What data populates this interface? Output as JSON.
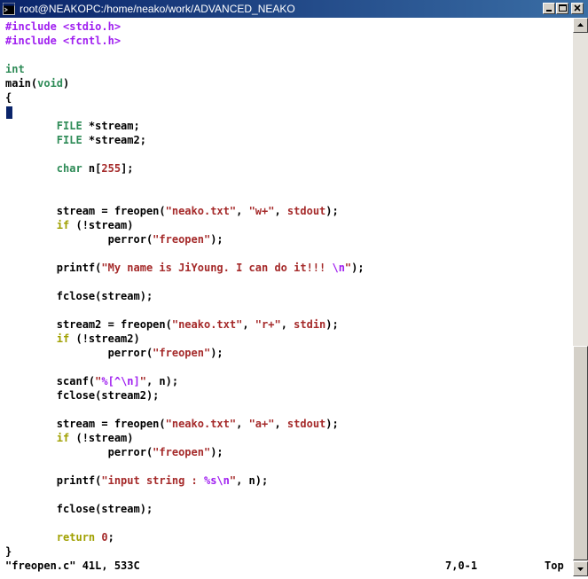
{
  "window": {
    "title": "root@NEAKOPC:/home/neako/work/ADVANCED_NEAKO"
  },
  "editor": {
    "lines": [
      {
        "parts": [
          {
            "t": "#include <stdio.h>",
            "c": "pre"
          }
        ]
      },
      {
        "parts": [
          {
            "t": "#include <fcntl.h>",
            "c": "pre"
          }
        ]
      },
      {
        "parts": []
      },
      {
        "parts": [
          {
            "t": "int",
            "c": "type"
          }
        ]
      },
      {
        "parts": [
          {
            "t": "main("
          },
          {
            "t": "void",
            "c": "type"
          },
          {
            "t": ")"
          }
        ]
      },
      {
        "parts": [
          {
            "t": "{"
          }
        ]
      },
      {
        "parts": []
      },
      {
        "parts": [
          {
            "t": "        "
          },
          {
            "t": "FILE",
            "c": "type"
          },
          {
            "t": " *stream;"
          }
        ]
      },
      {
        "parts": [
          {
            "t": "        "
          },
          {
            "t": "FILE",
            "c": "type"
          },
          {
            "t": " *stream2;"
          }
        ]
      },
      {
        "parts": []
      },
      {
        "parts": [
          {
            "t": "        "
          },
          {
            "t": "char",
            "c": "type"
          },
          {
            "t": " n["
          },
          {
            "t": "255",
            "c": "const"
          },
          {
            "t": "];"
          }
        ]
      },
      {
        "parts": []
      },
      {
        "parts": []
      },
      {
        "parts": [
          {
            "t": "        stream = freopen("
          },
          {
            "t": "\"neako.txt\"",
            "c": "str"
          },
          {
            "t": ", "
          },
          {
            "t": "\"w+\"",
            "c": "str"
          },
          {
            "t": ", "
          },
          {
            "t": "stdout",
            "c": "str"
          },
          {
            "t": ");"
          }
        ]
      },
      {
        "parts": [
          {
            "t": "        "
          },
          {
            "t": "if",
            "c": "stmt"
          },
          {
            "t": " (!stream)"
          }
        ]
      },
      {
        "parts": [
          {
            "t": "                perror("
          },
          {
            "t": "\"freopen\"",
            "c": "str"
          },
          {
            "t": ");"
          }
        ]
      },
      {
        "parts": []
      },
      {
        "parts": [
          {
            "t": "        printf("
          },
          {
            "t": "\"My name is JiYoung. I can do it!!! ",
            "c": "str"
          },
          {
            "t": "\\n",
            "c": "esc"
          },
          {
            "t": "\"",
            "c": "str"
          },
          {
            "t": ");"
          }
        ]
      },
      {
        "parts": []
      },
      {
        "parts": [
          {
            "t": "        fclose(stream);"
          }
        ]
      },
      {
        "parts": []
      },
      {
        "parts": [
          {
            "t": "        stream2 = freopen("
          },
          {
            "t": "\"neako.txt\"",
            "c": "str"
          },
          {
            "t": ", "
          },
          {
            "t": "\"r+\"",
            "c": "str"
          },
          {
            "t": ", "
          },
          {
            "t": "stdin",
            "c": "str"
          },
          {
            "t": ");"
          }
        ]
      },
      {
        "parts": [
          {
            "t": "        "
          },
          {
            "t": "if",
            "c": "stmt"
          },
          {
            "t": " (!stream2)"
          }
        ]
      },
      {
        "parts": [
          {
            "t": "                perror("
          },
          {
            "t": "\"freopen\"",
            "c": "str"
          },
          {
            "t": ");"
          }
        ]
      },
      {
        "parts": []
      },
      {
        "parts": [
          {
            "t": "        scanf("
          },
          {
            "t": "\"",
            "c": "str"
          },
          {
            "t": "%[^\\n]",
            "c": "esc"
          },
          {
            "t": "\"",
            "c": "str"
          },
          {
            "t": ", n);"
          }
        ]
      },
      {
        "parts": [
          {
            "t": "        fclose(stream2);"
          }
        ]
      },
      {
        "parts": []
      },
      {
        "parts": [
          {
            "t": "        stream = freopen("
          },
          {
            "t": "\"neako.txt\"",
            "c": "str"
          },
          {
            "t": ", "
          },
          {
            "t": "\"a+\"",
            "c": "str"
          },
          {
            "t": ", "
          },
          {
            "t": "stdout",
            "c": "str"
          },
          {
            "t": ");"
          }
        ]
      },
      {
        "parts": [
          {
            "t": "        "
          },
          {
            "t": "if",
            "c": "stmt"
          },
          {
            "t": " (!stream)"
          }
        ]
      },
      {
        "parts": [
          {
            "t": "                perror("
          },
          {
            "t": "\"freopen\"",
            "c": "str"
          },
          {
            "t": ");"
          }
        ]
      },
      {
        "parts": []
      },
      {
        "parts": [
          {
            "t": "        printf("
          },
          {
            "t": "\"input string : ",
            "c": "str"
          },
          {
            "t": "%s\\n",
            "c": "esc"
          },
          {
            "t": "\"",
            "c": "str"
          },
          {
            "t": ", n);"
          }
        ]
      },
      {
        "parts": []
      },
      {
        "parts": [
          {
            "t": "        fclose(stream);"
          }
        ]
      },
      {
        "parts": []
      },
      {
        "parts": [
          {
            "t": "        "
          },
          {
            "t": "return",
            "c": "stmt"
          },
          {
            "t": " "
          },
          {
            "t": "0",
            "c": "const"
          },
          {
            "t": ";"
          }
        ]
      },
      {
        "parts": [
          {
            "t": "}"
          }
        ]
      }
    ]
  },
  "status": {
    "file": "\"freopen.c\" 41L, 533C",
    "position": "7,0-1",
    "scroll": "Top"
  },
  "colors": {
    "preproc": "#a020f0",
    "type": "#2e8b57",
    "string": "#a52a2a",
    "statement": "#a0a000",
    "cursor": "#0a246a"
  },
  "icons": [
    "terminal-icon",
    "minimize-icon",
    "maximize-icon",
    "close-icon",
    "scroll-up-icon",
    "scroll-down-icon"
  ]
}
